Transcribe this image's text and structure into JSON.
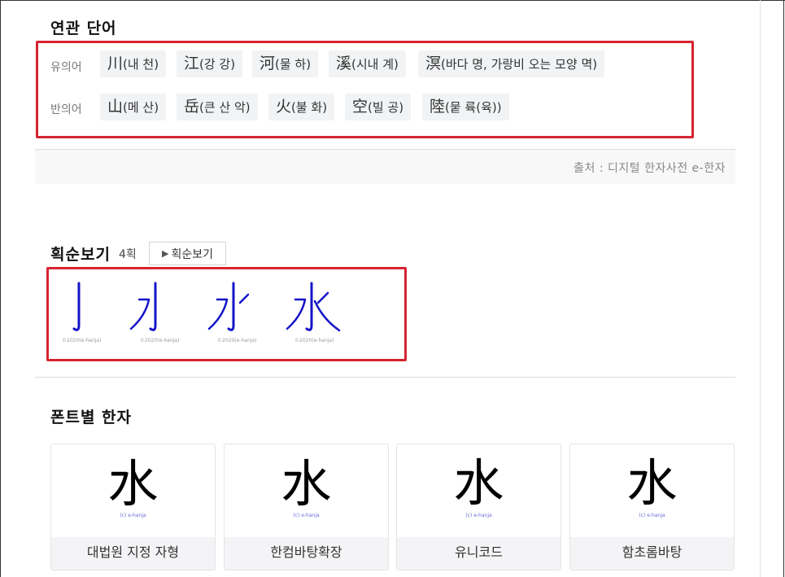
{
  "related_words": {
    "title": "연관 단어",
    "synonym_label": "유의어",
    "antonym_label": "반의어",
    "synonyms": [
      {
        "hanja": "川",
        "reading": "(내 천)"
      },
      {
        "hanja": "江",
        "reading": "(강 강)"
      },
      {
        "hanja": "河",
        "reading": "(물 하)"
      },
      {
        "hanja": "溪",
        "reading": "(시내 계)"
      },
      {
        "hanja": "溟",
        "reading": "(바다 명, 가랑비 오는 모양 멱)"
      }
    ],
    "antonyms": [
      {
        "hanja": "山",
        "reading": "(메 산)"
      },
      {
        "hanja": "岳",
        "reading": "(큰 산 악)"
      },
      {
        "hanja": "火",
        "reading": "(불 화)"
      },
      {
        "hanja": "空",
        "reading": "(빌 공)"
      },
      {
        "hanja": "陸",
        "reading": "(뭍 륙(육))"
      }
    ],
    "source": "출처 : 디지털 한자사전 e-한자"
  },
  "stroke_order": {
    "title": "획순보기",
    "count": "4획",
    "button_label": "획순보기",
    "frame_credit": "©2020(e-hanja)",
    "frames": 4
  },
  "fonts": {
    "title": "폰트별 한자",
    "glyph": "水",
    "credit": "(c) e-hanja",
    "cards": [
      {
        "name": "대법원 지정 자형"
      },
      {
        "name": "한컴바탕확장"
      },
      {
        "name": "유니코드"
      },
      {
        "name": "함초롬바탕"
      }
    ]
  },
  "colors": {
    "highlight_border": "#d62431",
    "stroke_blue": "#1414c8",
    "chip_bg": "#f1f3f5"
  }
}
